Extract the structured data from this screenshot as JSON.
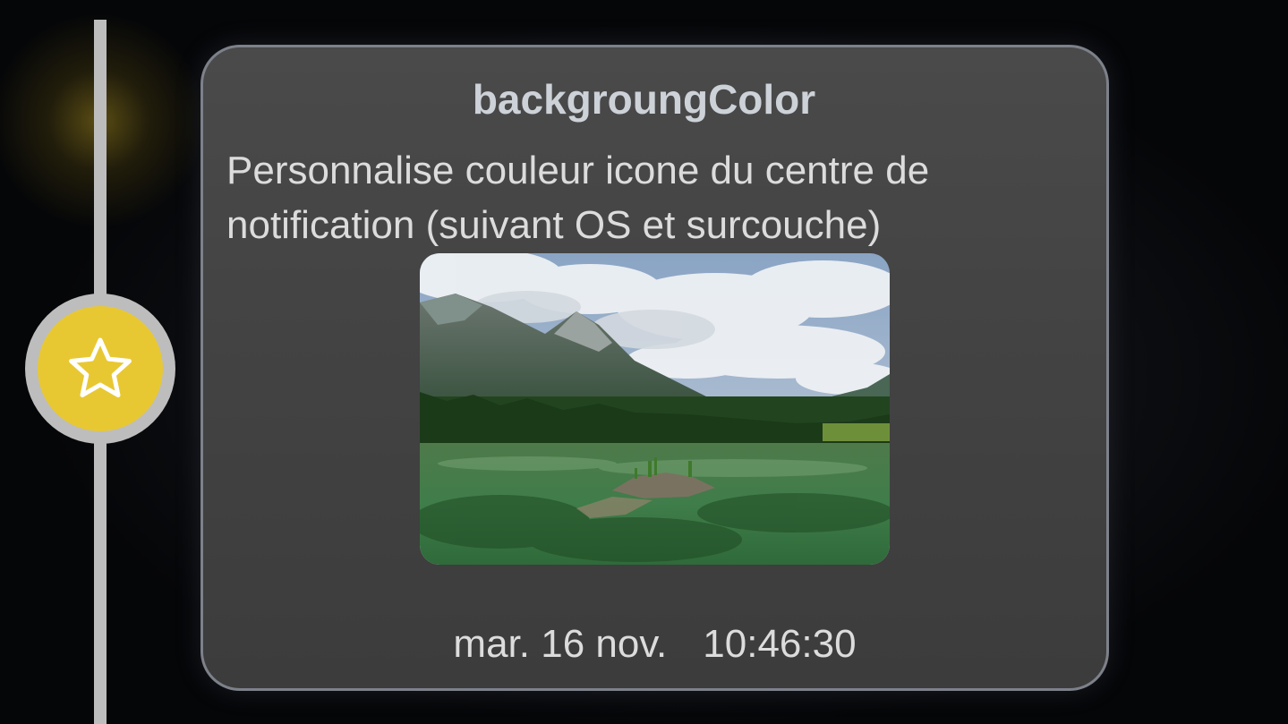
{
  "notification": {
    "title": "backgroungColor",
    "body": "Personnalise couleur icone du centre de notification (suivant OS et surcouche)",
    "date": "mar. 16 nov.",
    "time": "10:46:30",
    "image": "mountain-lake-landscape",
    "icon": "star-icon"
  },
  "colors": {
    "node_fill": "#e8c832",
    "node_ring": "#bdbdbd",
    "timeline": "#bdbdbd",
    "card_border": "#7d818a",
    "card_bg": "#454545"
  }
}
